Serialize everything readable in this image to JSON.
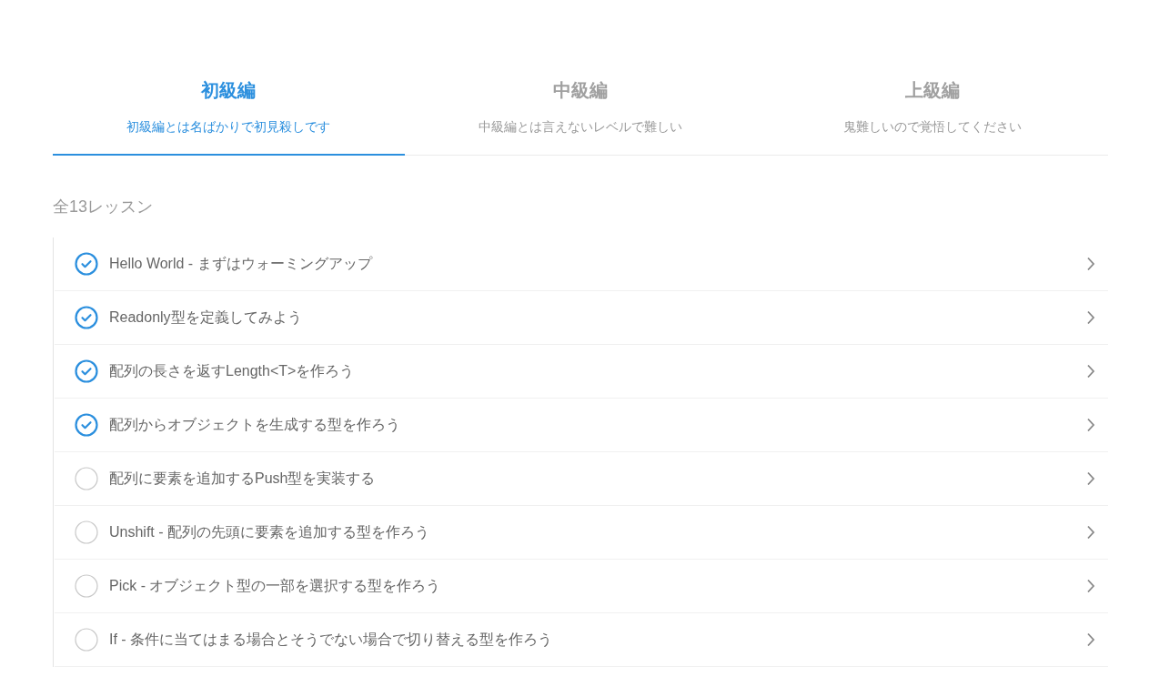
{
  "tabs": [
    {
      "label": "初級編",
      "description": "初級編とは名ばかりで初見殺しです",
      "selected": true
    },
    {
      "label": "中級編",
      "description": "中級編とは言えないレベルで難しい",
      "selected": false
    },
    {
      "label": "上級編",
      "description": "鬼難しいので覚悟してください",
      "selected": false
    }
  ],
  "lesson_count": "全13レッスン",
  "lessons": [
    {
      "title": "Hello World - まずはウォーミングアップ",
      "completed": true
    },
    {
      "title": "Readonly型を定義してみよう",
      "completed": true
    },
    {
      "title": "配列の長さを返すLength<T>を作ろう",
      "completed": true
    },
    {
      "title": "配列からオブジェクトを生成する型を作ろう",
      "completed": true
    },
    {
      "title": "配列に要素を追加するPush型を実装する",
      "completed": false
    },
    {
      "title": "Unshift - 配列の先頭に要素を追加する型を作ろう",
      "completed": false
    },
    {
      "title": "Pick - オブジェクト型の一部を選択する型を作ろう",
      "completed": false
    },
    {
      "title": "If - 条件に当てはまる場合とそうでない場合で切り替える型を作ろう",
      "completed": false
    }
  ]
}
